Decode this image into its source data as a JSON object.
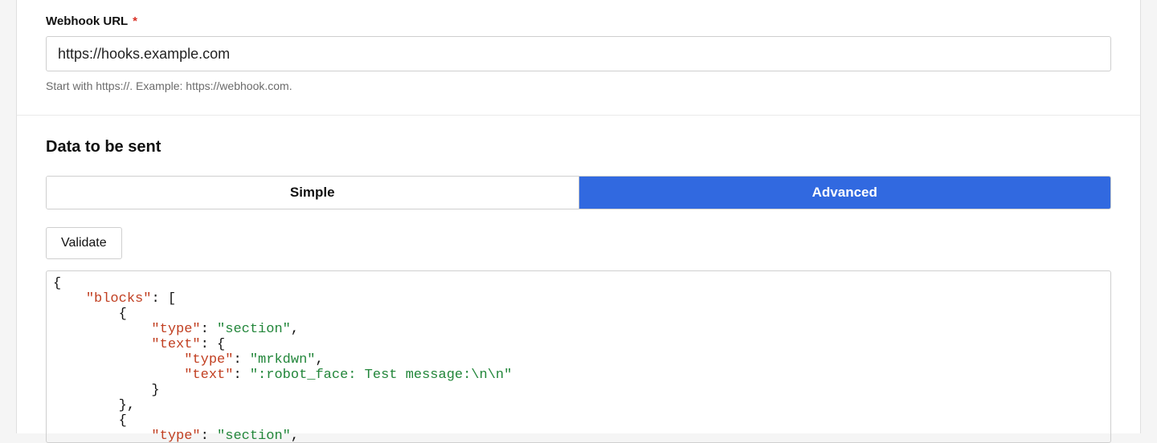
{
  "webhook": {
    "label": "Webhook URL",
    "required_mark": "*",
    "value": "https://hooks.example.com",
    "helper": "Start with https://. Example: https://webhook.com."
  },
  "data_section": {
    "heading": "Data to be sent",
    "tabs": {
      "simple": "Simple",
      "advanced": "Advanced"
    },
    "validate_label": "Validate",
    "json_tokens": [
      {
        "t": "p",
        "v": "{"
      },
      {
        "t": "nl"
      },
      {
        "t": "p",
        "v": "    "
      },
      {
        "t": "k",
        "v": "\"blocks\""
      },
      {
        "t": "p",
        "v": ": ["
      },
      {
        "t": "nl"
      },
      {
        "t": "p",
        "v": "        {"
      },
      {
        "t": "nl"
      },
      {
        "t": "p",
        "v": "            "
      },
      {
        "t": "k",
        "v": "\"type\""
      },
      {
        "t": "p",
        "v": ": "
      },
      {
        "t": "s",
        "v": "\"section\""
      },
      {
        "t": "p",
        "v": ","
      },
      {
        "t": "nl"
      },
      {
        "t": "p",
        "v": "            "
      },
      {
        "t": "k",
        "v": "\"text\""
      },
      {
        "t": "p",
        "v": ": {"
      },
      {
        "t": "nl"
      },
      {
        "t": "p",
        "v": "                "
      },
      {
        "t": "k",
        "v": "\"type\""
      },
      {
        "t": "p",
        "v": ": "
      },
      {
        "t": "s",
        "v": "\"mrkdwn\""
      },
      {
        "t": "p",
        "v": ","
      },
      {
        "t": "nl"
      },
      {
        "t": "p",
        "v": "                "
      },
      {
        "t": "k",
        "v": "\"text\""
      },
      {
        "t": "p",
        "v": ": "
      },
      {
        "t": "s",
        "v": "\":robot_face: Test message:\\n\\n\""
      },
      {
        "t": "nl"
      },
      {
        "t": "p",
        "v": "            }"
      },
      {
        "t": "nl"
      },
      {
        "t": "p",
        "v": "        },"
      },
      {
        "t": "nl"
      },
      {
        "t": "p",
        "v": "        {"
      },
      {
        "t": "nl"
      },
      {
        "t": "p",
        "v": "            "
      },
      {
        "t": "k",
        "v": "\"type\""
      },
      {
        "t": "p",
        "v": ": "
      },
      {
        "t": "s",
        "v": "\"section\""
      },
      {
        "t": "p",
        "v": ","
      },
      {
        "t": "nl"
      }
    ]
  }
}
